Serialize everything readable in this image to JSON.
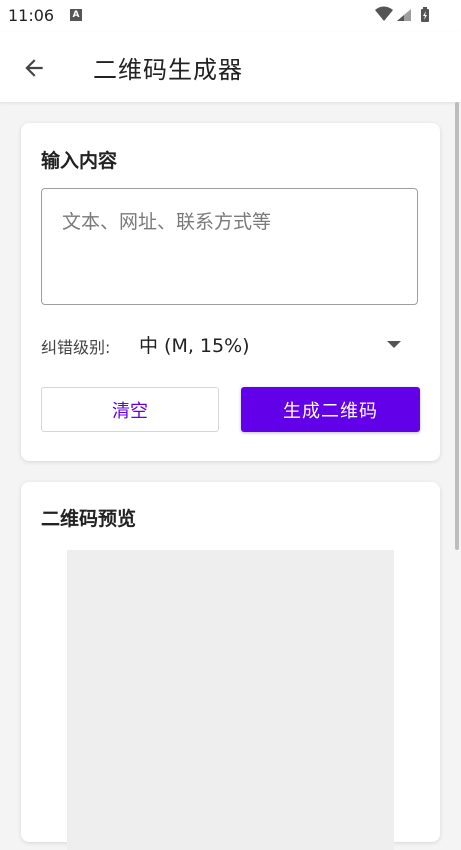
{
  "status_bar": {
    "time": "11:06",
    "notification_icon": "a-icon",
    "right_icons": [
      "wifi-icon",
      "signal-icon",
      "battery-icon"
    ]
  },
  "app_bar": {
    "back_icon": "arrow-left-icon",
    "title": "二维码生成器"
  },
  "input_card": {
    "title": "输入内容",
    "input_value": "",
    "input_placeholder": "文本、网址、联系方式等",
    "ecc_label": "纠错级别:",
    "ecc_selected": "中 (M, 15%)",
    "clear_label": "清空",
    "generate_label": "生成二维码"
  },
  "preview_card": {
    "title": "二维码预览"
  },
  "colors": {
    "accent": "#6200ea",
    "background": "#f4f4f4",
    "card": "#ffffff",
    "preview_placeholder": "#eeeeee"
  }
}
